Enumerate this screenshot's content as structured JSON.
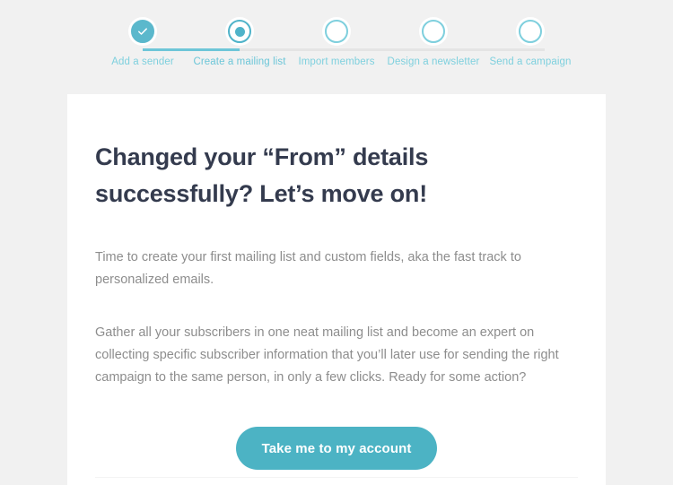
{
  "theme": {
    "page_background": "#f1f1f1",
    "card_background": "#ffffff",
    "accent": "#4cb3c4",
    "step_label_color": "#7ed0de",
    "heading_color": "#343b4e",
    "body_text_color": "#8d8d8d",
    "connector_done_color": "#6ec6d8",
    "connector_todo_color": "#e4e4e4"
  },
  "stepper": {
    "steps": [
      {
        "label": "Add a sender",
        "state": "done",
        "icon": "check-icon"
      },
      {
        "label": "Create a mailing list",
        "state": "current",
        "icon": "dot-icon"
      },
      {
        "label": "Import members",
        "state": "todo",
        "icon": "empty-circle-icon"
      },
      {
        "label": "Design a newsletter",
        "state": "todo",
        "icon": "empty-circle-icon"
      },
      {
        "label": "Send a campaign",
        "state": "todo",
        "icon": "empty-circle-icon"
      }
    ]
  },
  "card": {
    "headline": "Changed your “From” details successfully? Let’s move on!",
    "paragraph_1": "Time to create your first mailing list and custom fields, aka the fast track to personalized emails.",
    "paragraph_2": "Gather all your subscribers in one neat mailing list and become an expert on collecting specific subscriber information that you’ll later use for sending the right campaign to the same person, in only a few clicks. Ready for some action?",
    "cta_label": "Take me to my account"
  }
}
